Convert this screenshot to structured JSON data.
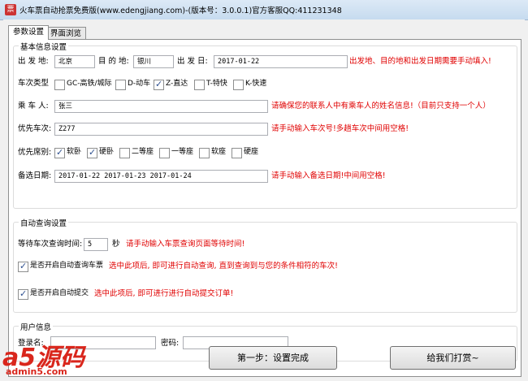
{
  "window": {
    "title": "火车票自动抢票免费版(www.edengjiang.com)-(版本号：3.0.0.1)官方客服QQ:411231348"
  },
  "tabs": [
    {
      "label": "参数设置"
    },
    {
      "label": "界面浏览"
    }
  ],
  "basic": {
    "title": "基本信息设置",
    "from_label": "出 发 地:",
    "from_value": "北京",
    "to_label": "目 的 地:",
    "to_value": "银川",
    "date_label": "出 发 日:",
    "date_value": "2017-01-22",
    "date_hint": "出发地、目的地和出发日期需要手动填入!",
    "train_type_label": "车次类型",
    "train_types": [
      {
        "label": "GC-高铁/城际",
        "checked": false
      },
      {
        "label": "D-动车",
        "checked": false
      },
      {
        "label": "Z-直达",
        "checked": true
      },
      {
        "label": "T-特快",
        "checked": false
      },
      {
        "label": "K-快速",
        "checked": false
      }
    ],
    "passenger_label": "乘 车 人:",
    "passenger_value": "张三",
    "passenger_hint": "请确保您的联系人中有乘车人的姓名信息!（目前只支持一个人）",
    "priority_train_label": "优先车次:",
    "priority_train_value": "Z277",
    "priority_train_hint": "请手动输入车次号!多趟车次中间用空格!",
    "seat_label": "优先席别:",
    "seats": [
      {
        "label": "软卧",
        "checked": true
      },
      {
        "label": "硬卧",
        "checked": true
      },
      {
        "label": "二等座",
        "checked": false
      },
      {
        "label": "一等座",
        "checked": false
      },
      {
        "label": "软座",
        "checked": false
      },
      {
        "label": "硬座",
        "checked": false
      }
    ],
    "alt_date_label": "备选日期:",
    "alt_date_value": "2017-01-22 2017-01-23 2017-01-24",
    "alt_date_hint": "请手动输入备选日期!中间用空格!"
  },
  "auto": {
    "title": "自动查询设置",
    "wait_label": "等待车次查询时间:",
    "wait_value": "5",
    "wait_unit": "秒",
    "wait_hint": "请手动输入车票查询页面等待时间!",
    "auto_query_label": "是否开启自动查询车票",
    "auto_query_checked": true,
    "auto_query_hint": "选中此项后, 即可进行自动查询, 直到查询到与您的条件相符的车次!",
    "auto_submit_label": "是否开启自动提交",
    "auto_submit_checked": true,
    "auto_submit_hint": "选中此项后, 即可进行进行自动提交订单!"
  },
  "user": {
    "title": "用户信息",
    "login_label": "登录名:",
    "login_value": "",
    "password_label": "密码:",
    "password_value": ""
  },
  "buttons": {
    "next": "第一步：设置完成",
    "tip": "给我们打赏~"
  },
  "watermark": {
    "logo": "a5源码",
    "url": "admin5.com"
  },
  "colors": {
    "hint": "#e00000",
    "watermark": "#d9261c"
  }
}
